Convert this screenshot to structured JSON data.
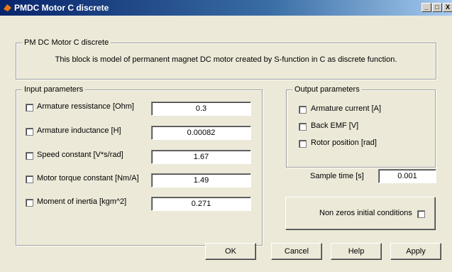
{
  "window": {
    "title": "PMDC Motor C discrete",
    "minimize": "_",
    "maximize": "□",
    "close": "X"
  },
  "description": {
    "legend": "PM DC Motor C discrete",
    "text": "This block is model of permanent magnet DC motor created by S-function in C as discrete function."
  },
  "input_parameters": {
    "legend": "Input parameters",
    "rows": [
      {
        "label": "Armature ressistance [Ohm]",
        "value": "0.3",
        "checked": false
      },
      {
        "label": "Armature inductance [H]",
        "value": "0.00082",
        "checked": false
      },
      {
        "label": "Speed constant [V*s/rad]",
        "value": "1.67",
        "checked": false
      },
      {
        "label": "Motor torque constant [Nm/A]",
        "value": "1.49",
        "checked": false
      },
      {
        "label": "Moment of inertia [kgm^2]",
        "value": "0.271",
        "checked": false
      }
    ]
  },
  "output_parameters": {
    "legend": "Output parameters",
    "rows": [
      {
        "label": "Armature current [A]",
        "checked": false
      },
      {
        "label": "Back EMF [V]",
        "checked": false
      },
      {
        "label": "Rotor position [rad]",
        "checked": false
      }
    ]
  },
  "sample_time": {
    "label": "Sample time [s]",
    "value": "0.001"
  },
  "initial_conditions": {
    "label": "Non zeros initial conditions",
    "checked": false
  },
  "buttons": {
    "ok": "OK",
    "cancel": "Cancel",
    "help": "Help",
    "apply": "Apply"
  },
  "colors": {
    "title_bar": "#0a246a",
    "background": "#ece9d8",
    "group_border": "#a0a0a0"
  }
}
